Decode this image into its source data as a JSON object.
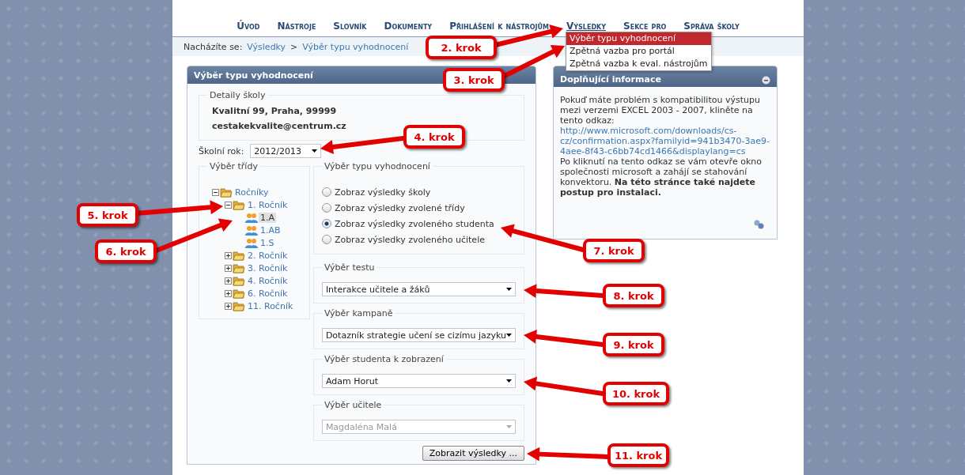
{
  "nav": [
    {
      "label": "Úvod",
      "selected": false
    },
    {
      "label": "Nástroje",
      "selected": false
    },
    {
      "label": "Slovník",
      "selected": false
    },
    {
      "label": "Dokumenty",
      "selected": false
    },
    {
      "label": "Přihlášení k nástrojům",
      "selected": false
    },
    {
      "label": "Výsledky",
      "selected": true
    },
    {
      "label": "Sekce pro",
      "selected": false
    },
    {
      "label": "Správa školy",
      "selected": false
    }
  ],
  "nav_menu": [
    {
      "label": "Výběr typu vyhodnocení",
      "selected": true
    },
    {
      "label": "Zpětná vazba pro portál",
      "selected": false
    },
    {
      "label": "Zpětná vazba k eval. nástrojům",
      "selected": false
    }
  ],
  "breadcrumb": {
    "label": "Nacházíte se:",
    "items": [
      "Výsledky",
      "Výběr typu vyhodnocení"
    ],
    "separator": ">"
  },
  "main_panel": {
    "title": "Výběr typu vyhodnocení",
    "school_details": {
      "legend": "Detaily školy",
      "lines": [
        "Kvalitní 99, Praha, 99999",
        "cestakekvalite@centrum.cz"
      ]
    },
    "school_year": {
      "label": "Školní rok:",
      "value": "2012/2013"
    },
    "class_tree": {
      "legend": "Výběr třídy",
      "nodes": [
        {
          "label": "Ročníky",
          "kind": "folder",
          "expanded": true,
          "selected": false,
          "children": [
            {
              "label": "1. Ročník",
              "kind": "folder",
              "expanded": true,
              "selected": false,
              "children": [
                {
                  "label": "1.A",
                  "kind": "group",
                  "selected": true
                },
                {
                  "label": "1.AB",
                  "kind": "group",
                  "selected": false
                },
                {
                  "label": "1.S",
                  "kind": "group",
                  "selected": false
                }
              ]
            },
            {
              "label": "2. Ročník",
              "kind": "folder",
              "expanded": false,
              "selected": false
            },
            {
              "label": "3. Ročník",
              "kind": "folder",
              "expanded": false,
              "selected": false
            },
            {
              "label": "4. Ročník",
              "kind": "folder",
              "expanded": false,
              "selected": false
            },
            {
              "label": "6. Ročník",
              "kind": "folder",
              "expanded": false,
              "selected": false
            },
            {
              "label": "11. Ročník",
              "kind": "folder",
              "expanded": false,
              "selected": false
            }
          ]
        }
      ]
    },
    "evaluation_type": {
      "legend": "Výběr typu vyhodnocení",
      "options": [
        {
          "label": "Zobraz výsledky školy",
          "selected": false
        },
        {
          "label": "Zobraz výsledky zvolené třídy",
          "selected": false
        },
        {
          "label": "Zobraz výsledky zvoleného studenta",
          "selected": true
        },
        {
          "label": "Zobraz výsledky zvoleného učitele",
          "selected": false
        }
      ]
    },
    "selects": [
      {
        "legend": "Výběr testu",
        "value": "Interakce učitele a žáků",
        "disabled": false
      },
      {
        "legend": "Výběr kampaně",
        "value": "Dotazník strategie učení se cizímu jazyku",
        "disabled": false
      },
      {
        "legend": "Výběr studenta k zobrazení",
        "value": "Adam Horut",
        "disabled": false
      },
      {
        "legend": "Výběr učitele",
        "value": "Magdaléna Malá",
        "disabled": true
      }
    ],
    "submit_button": "Zobrazit výsledky ..."
  },
  "side_panel": {
    "title": "Doplňující informace",
    "text_before": "Pokuď máte problém s kompatibilitou výstupu mezi verzemi EXCEL 2003 - 2007, kliněte na tento odkaz:",
    "link": "http://www.microsoft.com/downloads/cs-cz/confirmation.aspx?familyid=941b3470-3ae9-4aee-8f43-c6bb74cd1466&displaylang=cs",
    "text_after": "Po kliknutí na tento odkaz se vám otevře okno společnosti microsoft a zahájí se stahování konvektoru. **Na této stránce také najdete postup pro instalaci.**"
  },
  "callouts": [
    {
      "label": "2. krok"
    },
    {
      "label": "3. krok"
    },
    {
      "label": "4. krok"
    },
    {
      "label": "5. krok"
    },
    {
      "label": "6. krok"
    },
    {
      "label": "7. krok"
    },
    {
      "label": "8. krok"
    },
    {
      "label": "9. krok"
    },
    {
      "label": "10. krok"
    },
    {
      "label": "11. krok"
    }
  ]
}
